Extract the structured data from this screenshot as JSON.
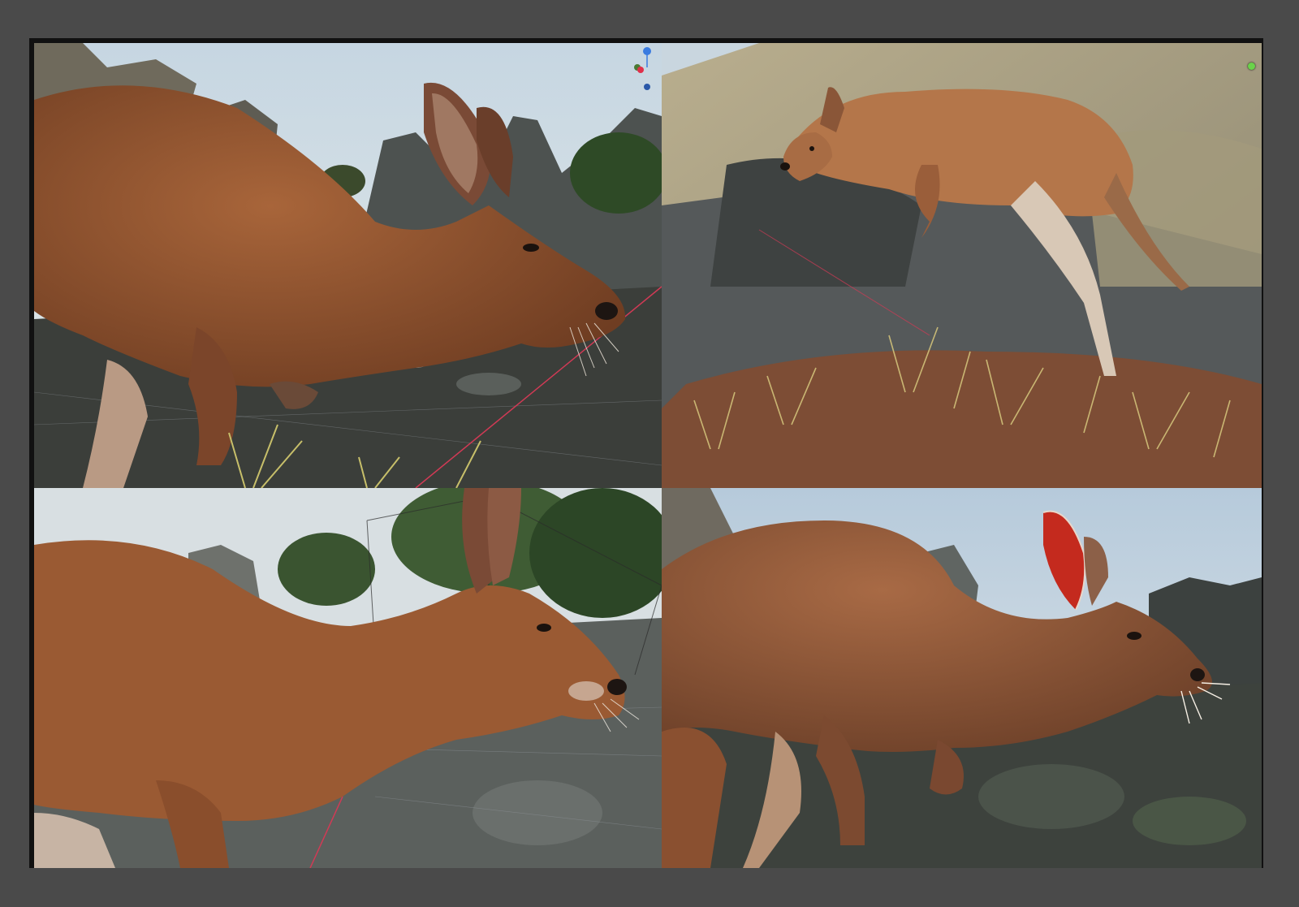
{
  "colors": {
    "page_background": "#4a4a4a",
    "frame_border": "#111111",
    "sky": "#cfdde6",
    "fur_main": "#9a5a33",
    "fur_dark": "#6e3c22",
    "fur_light": "#c79a74",
    "rock": "#4f5553",
    "rock_light": "#a99f86",
    "grass": "#b9b06a",
    "soil": "#7a4a32",
    "gizmo_x": "#e0304a",
    "gizmo_y": "#6ad24a",
    "gizmo_z": "#3a7be0"
  },
  "viewports": [
    {
      "id": "viewport-top-left",
      "view": "kangaroo-head-closeup-side",
      "gizmo": "navigation-axis-gizmo"
    },
    {
      "id": "viewport-top-right",
      "view": "kangaroo-full-body-on-rock",
      "gizmo": "green-indicator-dot"
    },
    {
      "id": "viewport-bottom-left",
      "view": "kangaroo-neck-head-wireframe-overlay",
      "gizmo": ""
    },
    {
      "id": "viewport-bottom-right",
      "view": "kangaroo-red-ear-backlit",
      "gizmo": ""
    }
  ],
  "gizmo_icons": [
    "axis-gizmo-icon",
    "z-axis-icon",
    "x-axis-icon",
    "y-axis-icon"
  ]
}
